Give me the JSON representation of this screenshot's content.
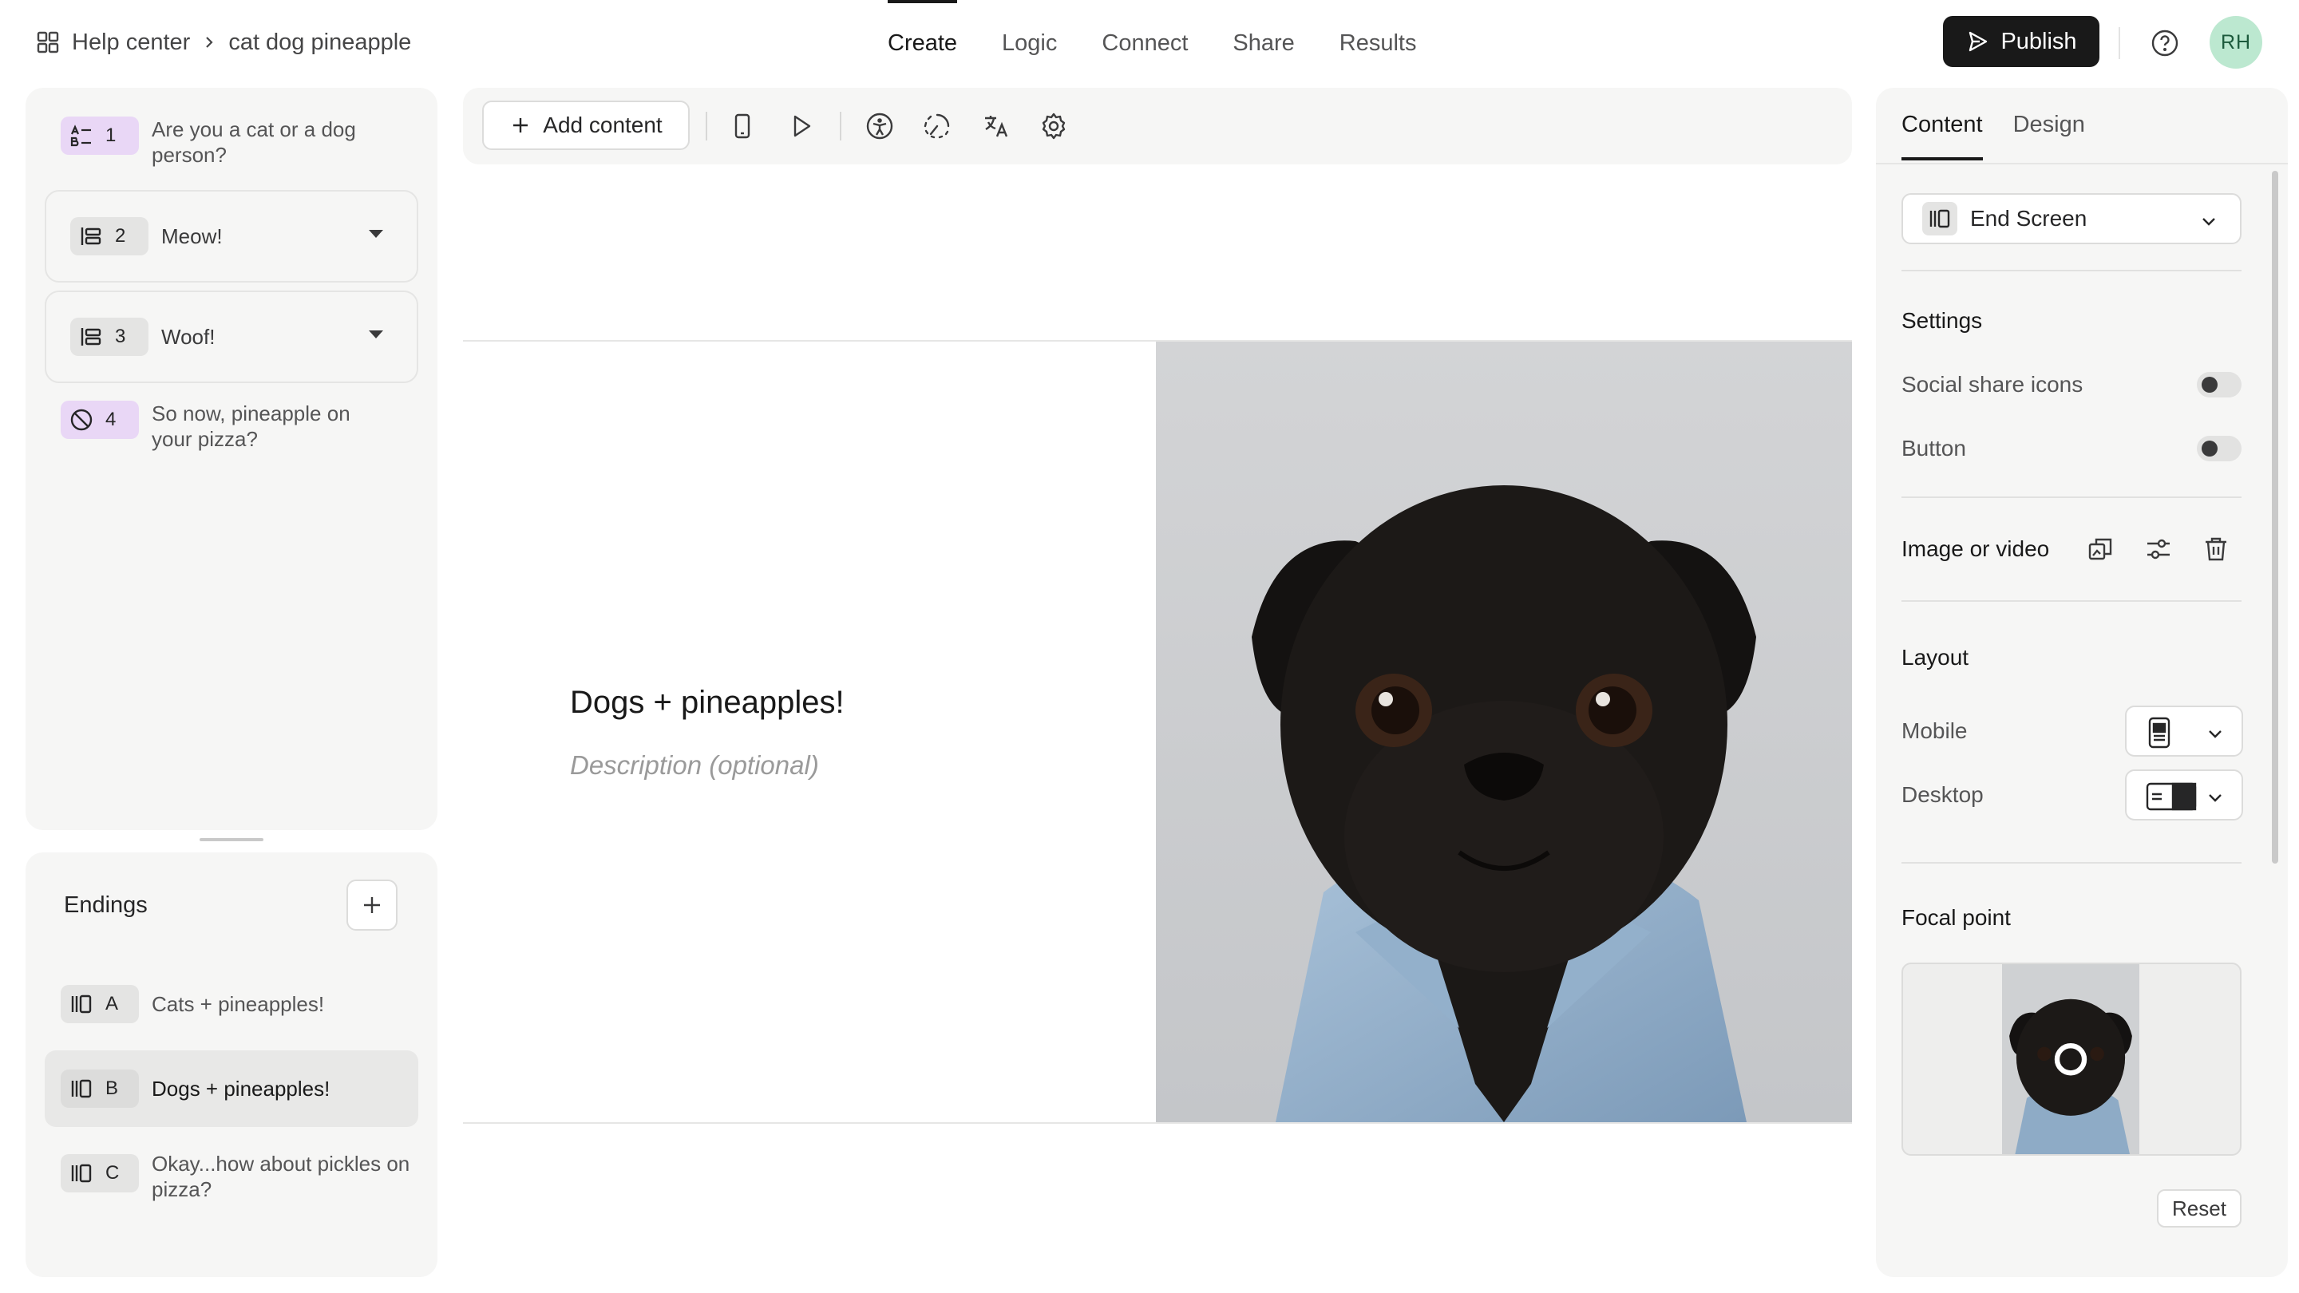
{
  "breadcrumb": {
    "root": "Help center",
    "current": "cat dog pineapple",
    "icons": {
      "home": "grid-icon",
      "separator": "chevron-right-icon"
    }
  },
  "nav": {
    "tabs": [
      "Create",
      "Logic",
      "Connect",
      "Share",
      "Results"
    ],
    "active": "Create"
  },
  "header": {
    "publish_label": "Publish",
    "avatar_initials": "RH",
    "help_icon": "help-circle-icon"
  },
  "questions": [
    {
      "number": "1",
      "text": "Are you a cat or a dog person?",
      "icon": "multiple-choice-icon",
      "color": "#e9d7f6"
    },
    {
      "number": "2",
      "text": "Meow!",
      "icon": "statement-icon",
      "color": "#e4e4e3"
    },
    {
      "number": "3",
      "text": "Woof!",
      "icon": "statement-icon",
      "color": "#e4e4e3"
    },
    {
      "number": "4",
      "text": "So now, pineapple on your pizza?",
      "icon": "no-entry-icon",
      "color": "#e9d7f6"
    }
  ],
  "endings": {
    "title": "Endings",
    "items": [
      {
        "letter": "A",
        "text": "Cats + pineapples!"
      },
      {
        "letter": "B",
        "text": "Dogs + pineapples!",
        "selected": true
      },
      {
        "letter": "C",
        "text": "Okay...how about pickles on pizza?"
      }
    ]
  },
  "toolbar": {
    "add_content_label": "Add content",
    "icons": [
      "mobile-preview-icon",
      "play-icon",
      "accessibility-icon",
      "loading-icon",
      "translate-icon",
      "settings-icon"
    ]
  },
  "canvas": {
    "title": "Dogs + pineapples!",
    "description_placeholder": "Description (optional)"
  },
  "right_panel": {
    "tabs": [
      "Content",
      "Design"
    ],
    "active_tab": "Content",
    "screen_type": "End Screen",
    "settings": {
      "heading": "Settings",
      "social_share_label": "Social share icons",
      "social_share_on": false,
      "button_label": "Button",
      "button_on": false
    },
    "media": {
      "label": "Image or video",
      "icons": [
        "replace-image-icon",
        "adjust-icon",
        "trash-icon"
      ]
    },
    "layout": {
      "heading": "Layout",
      "mobile_label": "Mobile",
      "desktop_label": "Desktop"
    },
    "focal": {
      "heading": "Focal point",
      "reset_label": "Reset"
    }
  }
}
